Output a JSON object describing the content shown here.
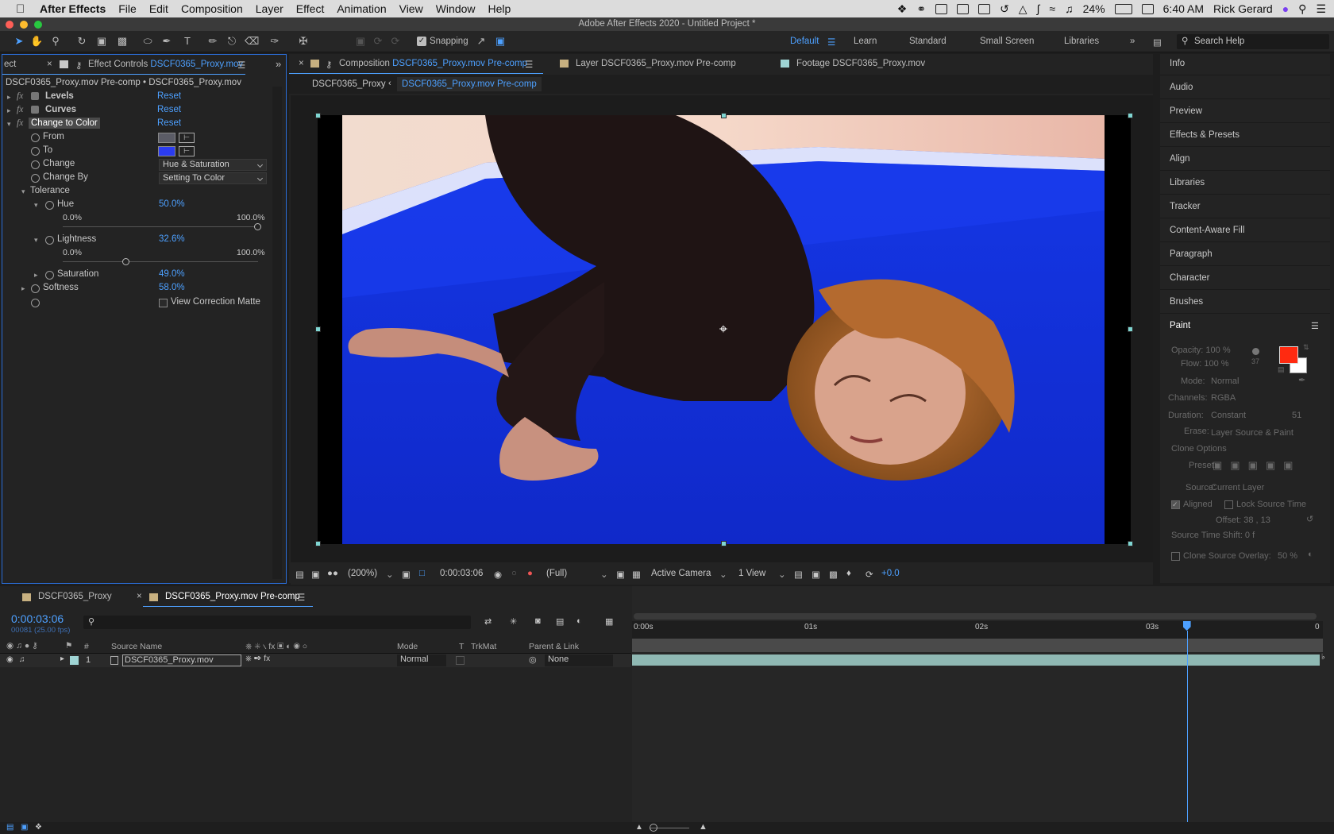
{
  "menubar": {
    "app": "After Effects",
    "items": [
      "File",
      "Edit",
      "Composition",
      "Layer",
      "Effect",
      "Animation",
      "View",
      "Window",
      "Help"
    ],
    "battery": "24%",
    "time": "6:40 AM",
    "user": "Rick Gerard"
  },
  "window": {
    "title": "Adobe After Effects 2020 - Untitled Project *"
  },
  "toolbar": {
    "snapping_label": "Snapping",
    "workspaces": [
      "Default",
      "Learn",
      "Standard",
      "Small Screen",
      "Libraries"
    ],
    "active_workspace": "Default",
    "search_placeholder": "Search Help"
  },
  "effects_panel": {
    "tab_cut": "ect",
    "tab_label": "Effect Controls",
    "tab_target": "DSCF0365_Proxy.mov",
    "breadcrumb": "DSCF0365_Proxy.mov Pre-comp • DSCF0365_Proxy.mov",
    "fx_symbol": "fx",
    "reset_label": "Reset",
    "effects": [
      "Levels",
      "Curves",
      "Change to Color"
    ],
    "props": {
      "from": "From",
      "to": "To",
      "change": "Change",
      "change_value": "Hue & Saturation",
      "change_by": "Change By",
      "change_by_value": "Setting To Color",
      "tolerance": "Tolerance",
      "hue": "Hue",
      "hue_value": "50.0%",
      "lightness": "Lightness",
      "lightness_value": "32.6%",
      "saturation": "Saturation",
      "saturation_value": "49.0%",
      "softness": "Softness",
      "softness_value": "58.0%",
      "view_matte": "View Correction Matte",
      "range_min": "0.0%",
      "range_max": "100.0%"
    },
    "hue_slider_fraction": 1.0,
    "lightness_slider_fraction": 0.326,
    "from_color": "#5b5c66",
    "to_color": "#2b3cf0"
  },
  "composition_panel": {
    "tabs": [
      {
        "prefix": "Composition",
        "name": "DSCF0365_Proxy.mov Pre-comp"
      },
      {
        "prefix": "Layer",
        "name": "DSCF0365_Proxy.mov Pre-comp"
      },
      {
        "prefix": "Footage",
        "name": "DSCF0365_Proxy.mov"
      }
    ],
    "crumbs": [
      "DSCF0365_Proxy",
      "DSCF0365_Proxy.mov Pre-comp"
    ],
    "zoom": "(200%)",
    "timecode": "0:00:03:06",
    "resolution": "(Full)",
    "camera": "Active Camera",
    "views": "1 View",
    "exposure": "+0.0"
  },
  "right_panels": [
    "Info",
    "Audio",
    "Preview",
    "Effects & Presets",
    "Align",
    "Libraries",
    "Tracker",
    "Content-Aware Fill",
    "Paragraph",
    "Character",
    "Brushes"
  ],
  "paint": {
    "title": "Paint",
    "opacity": "Opacity: 100 %",
    "flow": "Flow: 100 %",
    "brush_size": "37",
    "mode_label": "Mode:",
    "mode": "Normal",
    "channels_label": "Channels:",
    "channels": "RGBA",
    "duration_label": "Duration:",
    "duration": "Constant",
    "duration_frames": "51",
    "erase_label": "Erase:",
    "erase": "Layer Source & Paint",
    "clone_options": "Clone Options",
    "preset_label": "Preset:",
    "source_label": "Source:",
    "source": "Current Layer",
    "aligned": "Aligned",
    "lock_source": "Lock Source Time",
    "offset": "Offset: 38 ,        13",
    "source_time_shift": "Source Time Shift: 0  f",
    "clone_overlay": "Clone Source Overlay:",
    "overlay_pct": "50 %",
    "fg_color": "#ff2a10",
    "bg_color": "#ffffff"
  },
  "timeline": {
    "tabs": [
      "DSCF0365_Proxy",
      "DSCF0365_Proxy.mov Pre-comp"
    ],
    "timecode": "0:00:03:06",
    "frame_info": "00081 (25.00 fps)",
    "headers": {
      "hash": "#",
      "source": "Source Name",
      "mode": "Mode",
      "t": "T",
      "trkmat": "TrkMat",
      "parent": "Parent & Link"
    },
    "layer": {
      "index": "1",
      "name": "DSCF0365_Proxy.mov",
      "mode": "Normal",
      "parent": "None"
    },
    "ruler": [
      "0:00s",
      "01s",
      "02s",
      "03s"
    ],
    "end_marker": "0",
    "playhead_seconds": 3.24,
    "duration_seconds": 4.0
  }
}
